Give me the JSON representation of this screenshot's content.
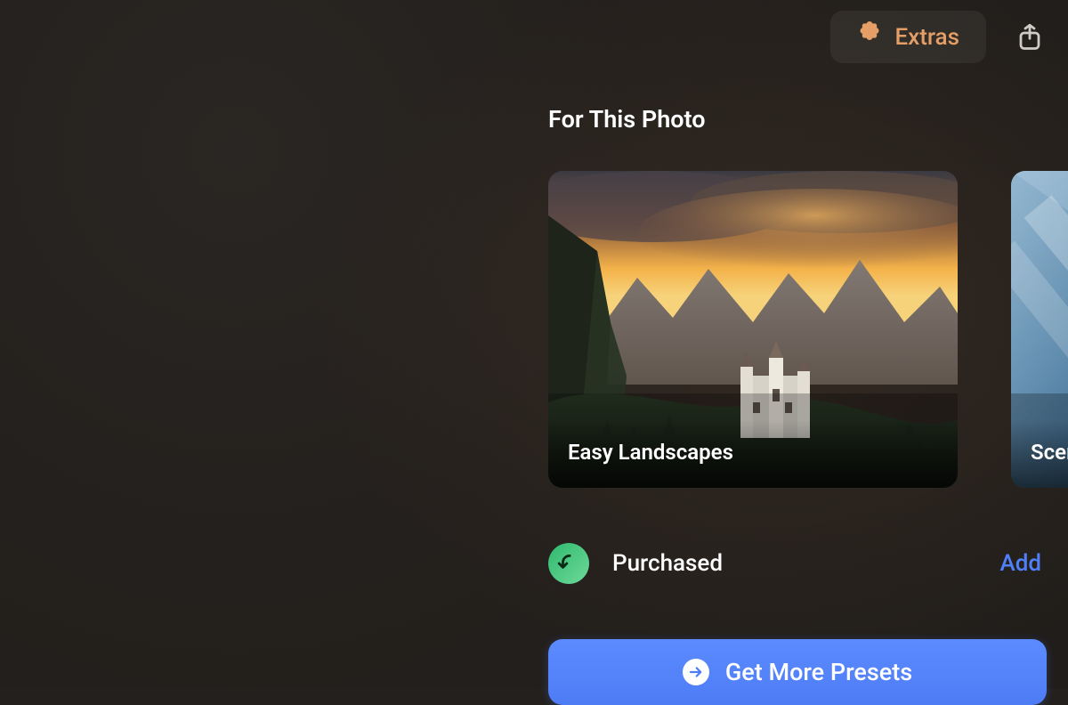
{
  "topbar": {
    "extras_label": "Extras"
  },
  "section": {
    "heading": "For This Photo"
  },
  "cards": {
    "items": [
      {
        "label": "Easy Landscapes"
      },
      {
        "label": "Scene"
      }
    ]
  },
  "purchased": {
    "label": "Purchased",
    "add_label": "Add"
  },
  "cta": {
    "label": "Get More Presets"
  },
  "colors": {
    "accent_orange": "#e49e66",
    "accent_blue": "#4f80f9"
  }
}
